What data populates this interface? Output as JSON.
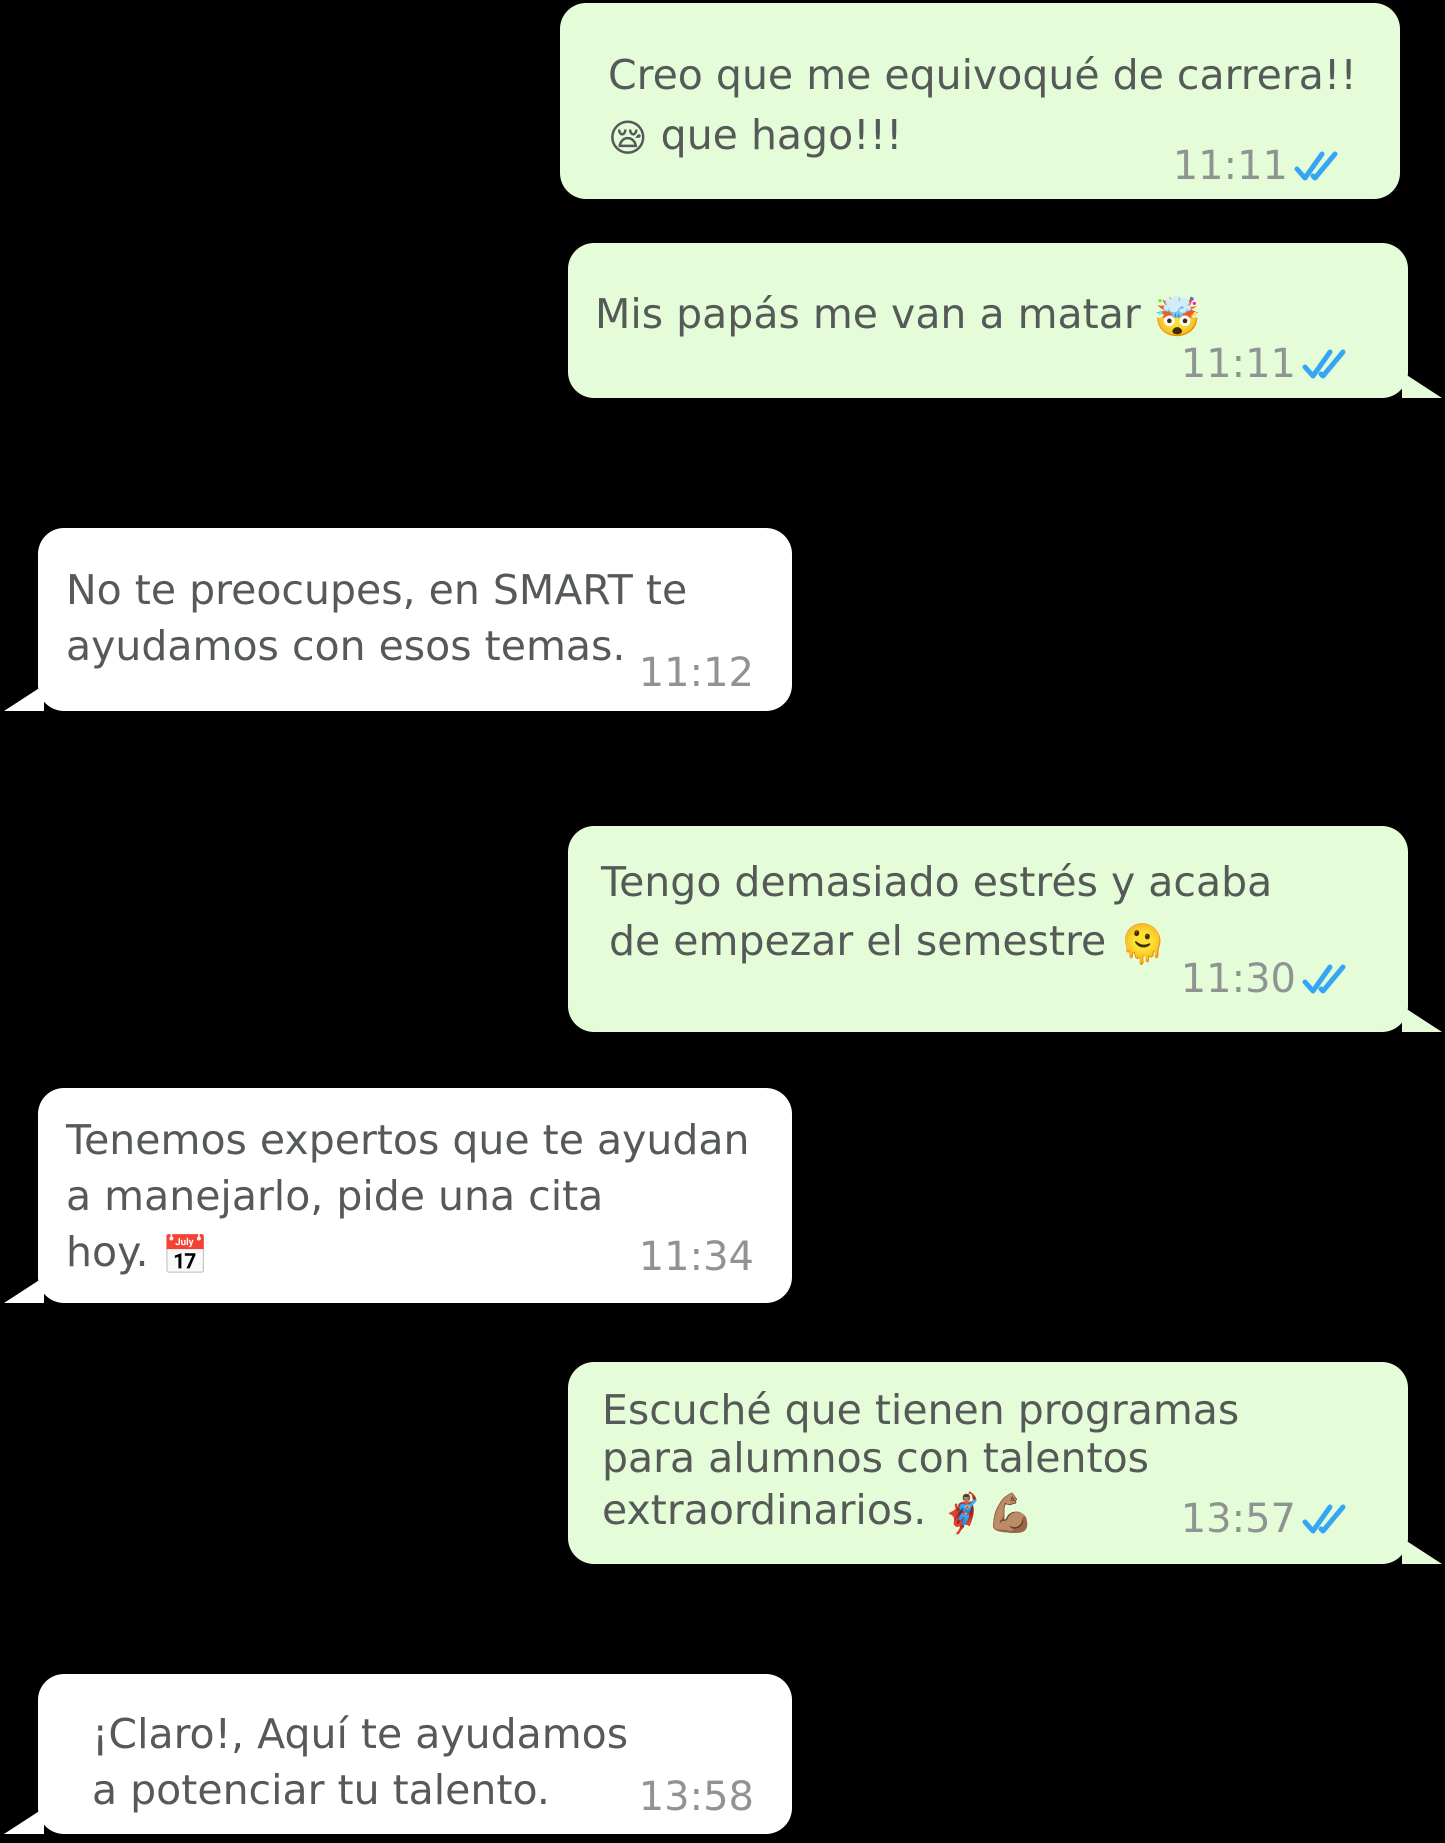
{
  "colors": {
    "background": "#000000",
    "outgoing_bubble": "#e5fcd8",
    "incoming_bubble": "#ffffff",
    "message_text": "#555a58",
    "timestamp": "#8f9492",
    "read_ticks": "#34a6f3"
  },
  "messages": [
    {
      "direction": "outgoing",
      "lines": [
        "Creo que me equivoqué de carrera!!",
        "que hago!!!"
      ],
      "emoji": {
        "line": 1,
        "position": "start",
        "char": "😪",
        "name": "sleepy-face-emoji"
      },
      "time": "11:11",
      "status_icon": "double-check-read-icon"
    },
    {
      "direction": "outgoing",
      "lines": [
        "Mis papás me van a matar"
      ],
      "emoji": {
        "line": 0,
        "position": "end",
        "char": "🤯",
        "name": "exploding-head-emoji"
      },
      "time": "11:11",
      "status_icon": "double-check-read-icon"
    },
    {
      "direction": "incoming",
      "lines": [
        "No te preocupes, en SMART te",
        "ayudamos con esos temas."
      ],
      "time": "11:12"
    },
    {
      "direction": "outgoing",
      "lines": [
        "Tengo demasiado estrés y acaba",
        "de empezar el semestre"
      ],
      "emoji": {
        "line": 1,
        "position": "end",
        "char": "🫠",
        "name": "melting-face-emoji"
      },
      "time": "11:30",
      "status_icon": "double-check-read-icon"
    },
    {
      "direction": "incoming",
      "lines": [
        "Tenemos expertos que te ayudan",
        "a manejarlo, pide una cita",
        "hoy."
      ],
      "emoji": {
        "line": 2,
        "position": "end",
        "char": "📅",
        "name": "calendar-emoji"
      },
      "time": "11:34"
    },
    {
      "direction": "outgoing",
      "lines": [
        "Escuché que tienen programas",
        "para alumnos con talentos",
        "extraordinarios."
      ],
      "emoji": {
        "line": 2,
        "position": "end",
        "char": "🦸🏽‍♂️💪🏽",
        "name": "superhero-flexed-biceps-emoji"
      },
      "time": "13:57",
      "status_icon": "double-check-read-icon"
    },
    {
      "direction": "incoming",
      "lines": [
        "¡Claro!, Aquí te ayudamos",
        "a potenciar tu talento."
      ],
      "time": "13:58"
    }
  ]
}
